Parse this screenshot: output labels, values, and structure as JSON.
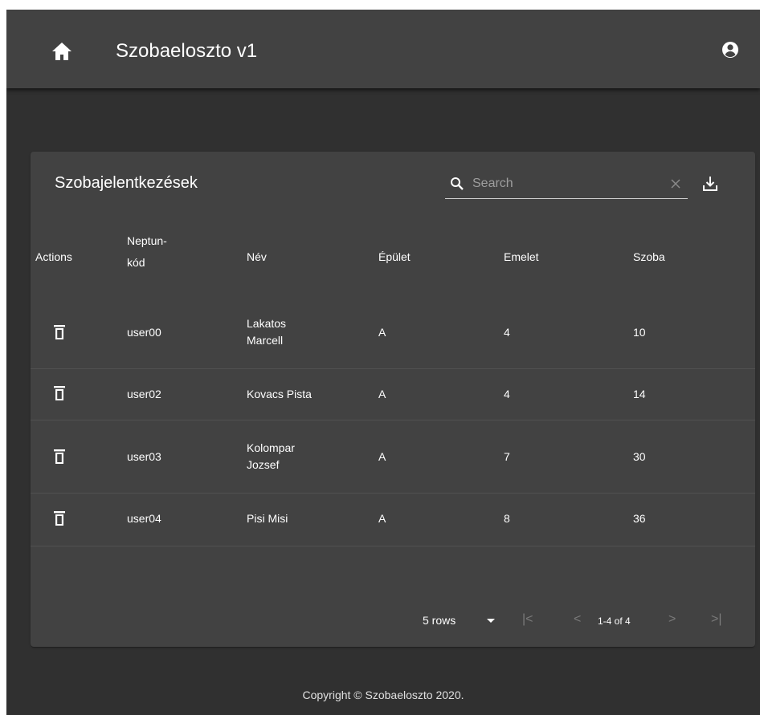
{
  "header": {
    "title": "Szobaeloszto v1",
    "home_icon": "home-icon",
    "account_icon": "account-circle-icon"
  },
  "table": {
    "title": "Szobajelentkezések",
    "search": {
      "placeholder": "Search",
      "value": ""
    },
    "columns": {
      "actions": "Actions",
      "neptun_line1": "Neptun-",
      "neptun_line2": "kód",
      "name": "Név",
      "building": "Épület",
      "floor": "Emelet",
      "room": "Szoba"
    },
    "rows": [
      {
        "neptun": "user00",
        "name_line1": "Lakatos",
        "name_line2": "Marcell",
        "building": "A",
        "floor": "4",
        "room": "10"
      },
      {
        "neptun": "user02",
        "name_line1": "Kovacs Pista",
        "name_line2": "",
        "building": "A",
        "floor": "4",
        "room": "14"
      },
      {
        "neptun": "user03",
        "name_line1": "Kolompar",
        "name_line2": "Jozsef",
        "building": "A",
        "floor": "7",
        "room": "30"
      },
      {
        "neptun": "user04",
        "name_line1": "Pisi Misi",
        "name_line2": "",
        "building": "A",
        "floor": "8",
        "room": "36"
      }
    ],
    "pagination": {
      "rows_per_page": "5 rows",
      "page_info": "1-4 of 4",
      "first": "|<",
      "prev": "<",
      "next": ">",
      "last": ">|"
    }
  },
  "footer": {
    "copyright": "Copyright © Szobaeloszto 2020."
  },
  "colors": {
    "background": "#303030",
    "surface": "#424242",
    "text": "#ffffff",
    "disabled": "#7a7a7a"
  }
}
